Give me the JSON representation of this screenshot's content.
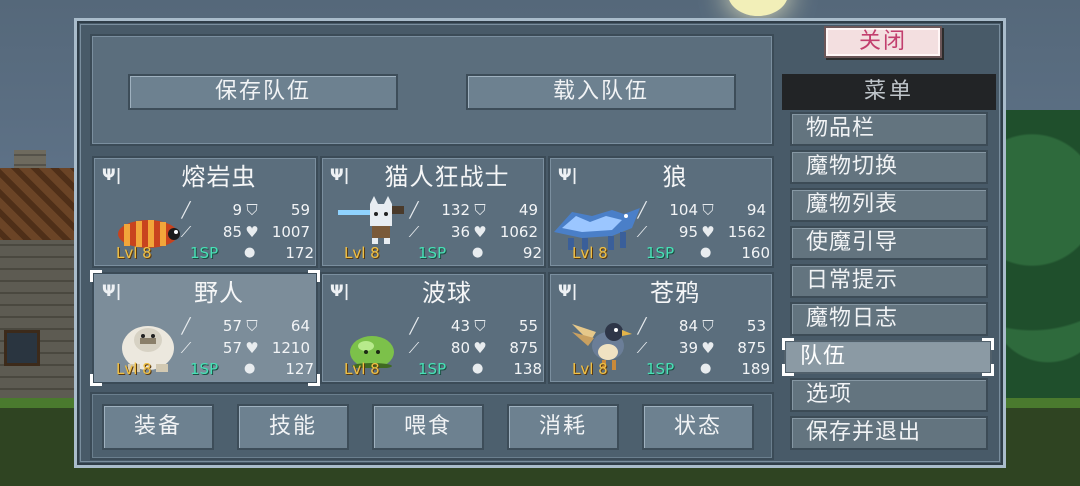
{
  "close_button": {
    "label": "关闭"
  },
  "team_actions": {
    "save_label": "保存队伍",
    "load_label": "载入队伍"
  },
  "party": [
    {
      "name": "熔岩虫",
      "atk": "9",
      "def": "59",
      "mag": "85",
      "hp": "1007",
      "level": "Lvl 8",
      "sp": "1SP",
      "food": "172",
      "sprite": "lava-worm"
    },
    {
      "name": "猫人狂战士",
      "atk": "132",
      "def": "49",
      "mag": "36",
      "hp": "1062",
      "level": "Lvl 8",
      "sp": "1SP",
      "food": "92",
      "sprite": "cat-berserker"
    },
    {
      "name": "狼",
      "atk": "104",
      "def": "94",
      "mag": "95",
      "hp": "1562",
      "level": "Lvl 8",
      "sp": "1SP",
      "food": "160",
      "sprite": "wolf"
    },
    {
      "name": "野人",
      "atk": "57",
      "def": "64",
      "mag": "57",
      "hp": "1210",
      "level": "Lvl 8",
      "sp": "1SP",
      "food": "127",
      "sprite": "yeti",
      "selected": true
    },
    {
      "name": "波球",
      "atk": "43",
      "def": "55",
      "mag": "80",
      "hp": "875",
      "level": "Lvl 8",
      "sp": "1SP",
      "food": "138",
      "sprite": "slime"
    },
    {
      "name": "苍鸦",
      "atk": "84",
      "def": "53",
      "mag": "39",
      "hp": "875",
      "level": "Lvl 8",
      "sp": "1SP",
      "food": "189",
      "sprite": "raven"
    }
  ],
  "actions": [
    "装备",
    "技能",
    "喂食",
    "消耗",
    "状态"
  ],
  "menu": {
    "header": "菜单",
    "items": [
      "物品栏",
      "魔物切换",
      "魔物列表",
      "使魔引导",
      "日常提示",
      "魔物日志",
      "队伍",
      "选项",
      "保存并退出"
    ],
    "active": "队伍"
  },
  "colors": {
    "level_text": "#f0c044",
    "sp_text": "#48e0b6",
    "close_text": "#c23f6e",
    "panel": "#5b6e7d"
  },
  "icons": {
    "fork_knife": "fork-knife-icon",
    "attack": "sword-icon",
    "defense": "shield-icon",
    "magic": "staff-icon",
    "health": "heart-icon",
    "food": "food-bag-icon"
  }
}
